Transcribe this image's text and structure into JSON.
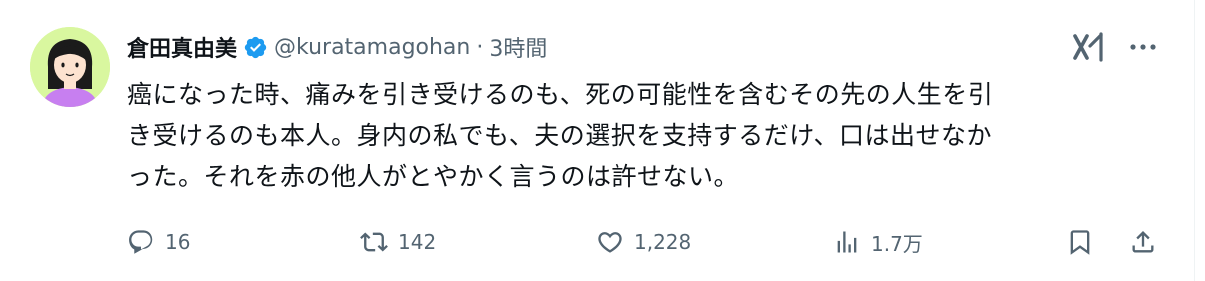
{
  "author": {
    "display_name": "倉田真由美",
    "handle": "@kuratamagohan",
    "separator": "·",
    "time": "3時間",
    "verified": true
  },
  "tweet": {
    "lines": [
      "癌になった時、痛みを引き受けるのも、死の可能性を含むその先の人生を引",
      "き受けるのも本人。身内の私でも、夫の選択を支持するだけ、口は出せなか",
      "った。それを赤の他人がとやかく言うのは許せない。"
    ]
  },
  "actions": {
    "replies": "16",
    "reposts": "142",
    "likes": "1,228",
    "views": "1.7万"
  },
  "icons": [
    "avatar",
    "verified-badge-icon",
    "grok-icon",
    "more-icon",
    "reply-icon",
    "repost-icon",
    "like-icon",
    "views-icon",
    "bookmark-icon",
    "share-icon"
  ],
  "colors": {
    "text": "#0f1419",
    "secondary": "#536471",
    "verified": "#1d9bf0",
    "avatar_bg": "#d9f79f"
  }
}
